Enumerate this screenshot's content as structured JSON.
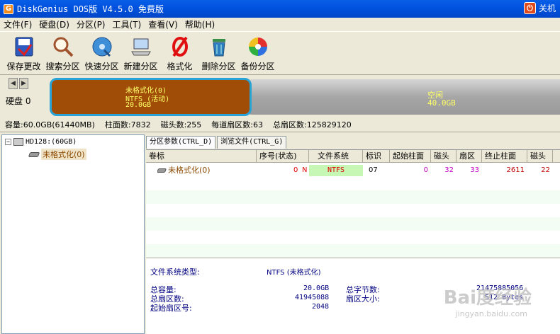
{
  "window": {
    "title": "DiskGenius DOS版 V4.5.0 免费版",
    "poweroff_label": "关机"
  },
  "menu": [
    "文件(F)",
    "硬盘(D)",
    "分区(P)",
    "工具(T)",
    "查看(V)",
    "帮助(H)"
  ],
  "toolbar": [
    {
      "label": "保存更改",
      "icon": "save-icon"
    },
    {
      "label": "搜索分区",
      "icon": "search-icon"
    },
    {
      "label": "快速分区",
      "icon": "disc-icon"
    },
    {
      "label": "新建分区",
      "icon": "computer-icon"
    },
    {
      "label": "格式化",
      "icon": "format-icon"
    },
    {
      "label": "删除分区",
      "icon": "trash-icon"
    },
    {
      "label": "备份分区",
      "icon": "backup-icon"
    }
  ],
  "diskmap": {
    "disk_label": "硬盘 0",
    "partition": {
      "name": "未格式化(0)",
      "fs": "NTFS (活动)",
      "size": "20.0GB"
    },
    "free": {
      "name": "空闲",
      "size": "40.0GB"
    }
  },
  "info": [
    "容量:60.0GB(61440MB)",
    "柱面数:7832",
    "磁头数:255",
    "每道扇区数:63",
    "总扇区数:125829120"
  ],
  "tree": {
    "disk": "HD128:(60GB)",
    "partition": "未格式化(0)"
  },
  "tabs": [
    "分区参数(CTRL_D)",
    "浏览文件(CTRL_G)"
  ],
  "table": {
    "headers": [
      "卷标",
      "序号(状态)",
      "文件系统",
      "标识",
      "起始柱面",
      "磁头",
      "扇区",
      "终止柱面",
      "磁头"
    ],
    "row": {
      "label": "未格式化(0)",
      "index": "0",
      "status": "N",
      "fs": "NTFS",
      "id": "07",
      "start_cyl": "0",
      "head": "32",
      "sector": "33",
      "end_cyl": "2611",
      "end_head": "22"
    }
  },
  "details": {
    "fs_type_label": "文件系统类型:",
    "fs_type_value": "NTFS (未格式化)",
    "capacity_label": "总容量:",
    "capacity_value": "20.0GB",
    "sectors_label": "总扇区数:",
    "sectors_value": "41945088",
    "start_sector_label": "起始扇区号:",
    "start_sector_value": "2048",
    "bytes_label": "总字节数:",
    "bytes_value": "21475885056",
    "sector_size_label": "扇区大小:",
    "sector_size_value": "512 Bytes"
  },
  "watermark": {
    "brand": "Bai度经验",
    "url": "jingyan.baidu.com"
  },
  "colors": {
    "partition": "#a04d08",
    "partition_border": "#2aa3d6",
    "label_yellow": "#ffff66",
    "status_red": "#e00000",
    "fs_bg": "#c6f7b4"
  }
}
